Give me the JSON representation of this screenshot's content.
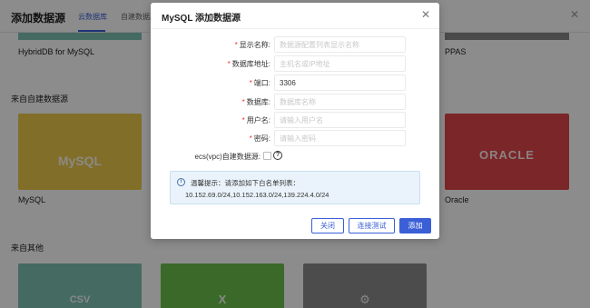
{
  "background": {
    "title": "添加数据源",
    "tabs": [
      {
        "label": "云数据库",
        "active": true
      },
      {
        "label": "自建数据库",
        "active": false
      }
    ],
    "cloud_cards": [
      {
        "label": "HybridDB for MySQL",
        "color": "#7fc1b3"
      },
      {
        "label": "PPAS",
        "color": "#888888"
      }
    ],
    "section_self_built": "来自自建数据源",
    "self_built_tiles": [
      {
        "label": "MySQL",
        "logo_text": "MySQL",
        "color": "#ecc94b"
      },
      {
        "label": "Oracle",
        "logo_text": "ORACLE",
        "color": "#e0454a"
      }
    ],
    "section_other": "来自其他",
    "other_tiles": [
      {
        "logo_text": "CSV",
        "color": "#7fc1b3"
      },
      {
        "logo_text": "X",
        "color": "#6cbf4e"
      },
      {
        "logo_text": "",
        "color": "#8a8a8a"
      }
    ]
  },
  "modal": {
    "title": "MySQL 添加数据源",
    "fields": [
      {
        "label": "显示名称:",
        "required": true,
        "value": "",
        "placeholder": "数据源配置列表显示名称"
      },
      {
        "label": "数据库地址:",
        "required": true,
        "value": "",
        "placeholder": "主机名或IP地址"
      },
      {
        "label": "端口:",
        "required": true,
        "value": "3306",
        "placeholder": ""
      },
      {
        "label": "数据库:",
        "required": true,
        "value": "",
        "placeholder": "数据库名称"
      },
      {
        "label": "用户名:",
        "required": true,
        "value": "",
        "placeholder": "请输入用户名"
      },
      {
        "label": "密码:",
        "required": true,
        "value": "",
        "placeholder": "请输入密码"
      }
    ],
    "ecs_label": "ecs(vpc)自建数据源:",
    "ecs_checked": false,
    "notice_line1": "温馨提示：请添加如下白名单列表：",
    "notice_line2": "10.152.69.0/24,10.152.163.0/24,139.224.4.0/24",
    "buttons": {
      "close": "关闭",
      "test": "连接测试",
      "add": "添加"
    }
  },
  "colors": {
    "accent": "#3a5fd7",
    "required": "#e33333",
    "notice_bg": "#eaf3fb"
  }
}
